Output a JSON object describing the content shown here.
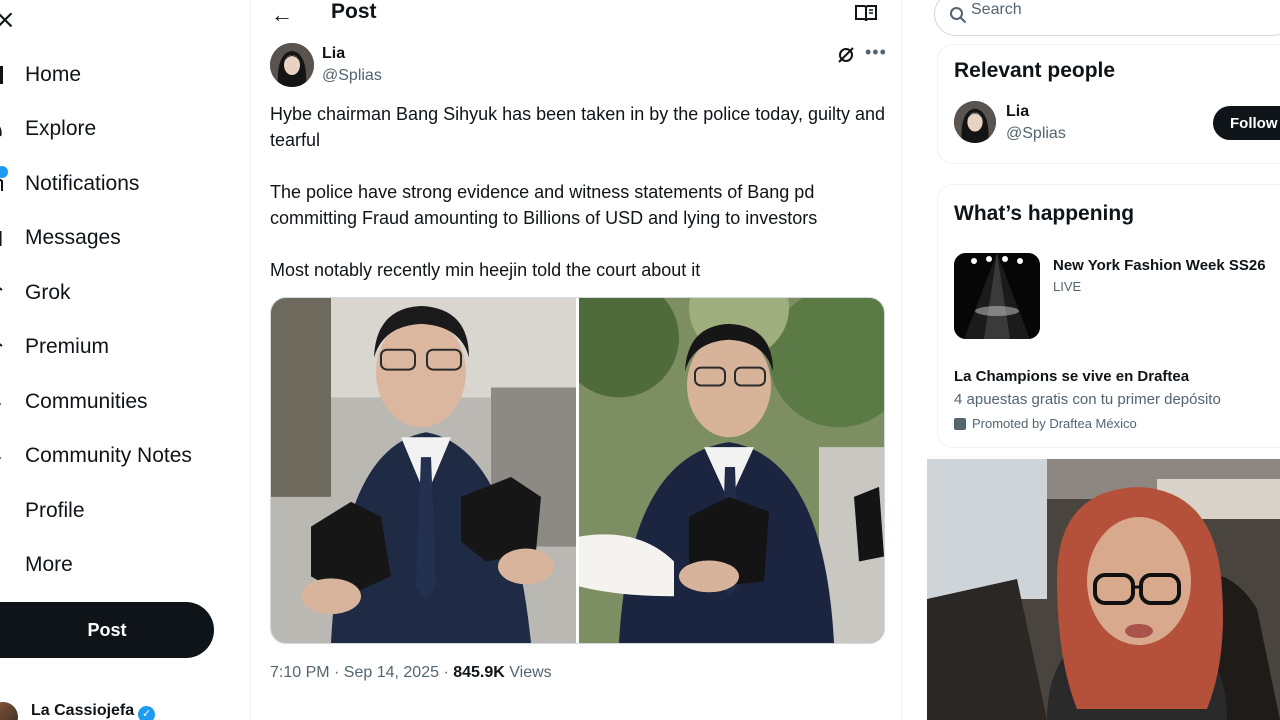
{
  "nav": {
    "items": [
      {
        "label": "Home",
        "icon": "home-icon"
      },
      {
        "label": "Explore",
        "icon": "search-icon"
      },
      {
        "label": "Notifications",
        "icon": "bell-icon"
      },
      {
        "label": "Messages",
        "icon": "envelope-icon"
      },
      {
        "label": "Grok",
        "icon": "grok-icon"
      },
      {
        "label": "Premium",
        "icon": "x-logo-icon"
      },
      {
        "label": "Communities",
        "icon": "people-icon"
      },
      {
        "label": "Community Notes",
        "icon": "notes-icon"
      },
      {
        "label": "Profile",
        "icon": "person-icon"
      },
      {
        "label": "More",
        "icon": "more-circle-icon"
      }
    ],
    "post_button": "Post",
    "account_name": "La Cassiojefa",
    "accent_color": "#1d9bf0"
  },
  "header": {
    "title": "Post",
    "back_icon": "arrow-left-icon",
    "reader_icon": "book-open-icon"
  },
  "post": {
    "author_name": "Lia",
    "author_handle": "@Splias",
    "paragraphs": [
      "Hybe chairman Bang Sihyuk has been taken in by the police today, guilty and tearful",
      "The police have strong evidence and witness statements of Bang pd committing Fraud amounting to Billions of USD and lying to investors",
      "Most notably recently min heejin told the court about it"
    ],
    "time": "7:10 PM · Sep 14, 2025 · ",
    "views_count": "845.9K",
    "views_label": " Views"
  },
  "search": {
    "placeholder": "Search"
  },
  "relevant_people": {
    "title": "Relevant people",
    "name": "Lia",
    "handle": "@Splias",
    "follow_label": "Follow"
  },
  "whats_happening": {
    "title": "What’s happening",
    "trend_title": "New York Fashion Week SS26",
    "trend_status": "LIVE",
    "ad_title": "La Champions se vive en Draftea",
    "ad_description": "4 apuestas gratis con tu primer depósito",
    "ad_promoted": "Promoted by Draftea México"
  }
}
